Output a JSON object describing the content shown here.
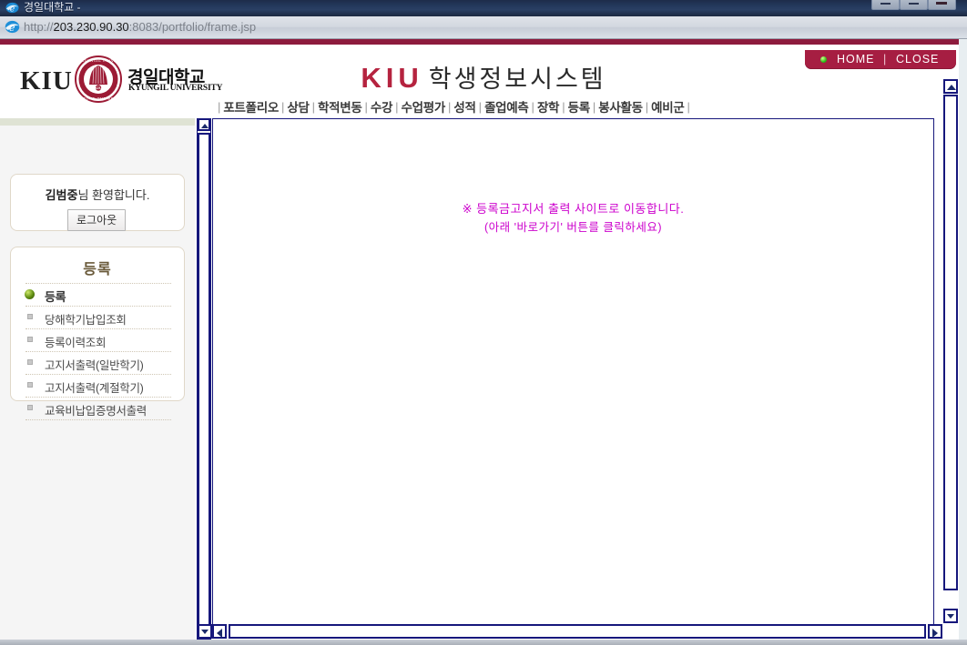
{
  "window": {
    "title": "경일대학교 -",
    "minimize_label": "Minimize",
    "maximize_label": "Maximize",
    "close_label": "Close"
  },
  "address_bar": {
    "protocol": "http://",
    "host": "203.230.90.30",
    "rest": ":8083/portfolio/frame.jsp",
    "full_url": "http://203.230.90.30:8083/portfolio/frame.jsp"
  },
  "header": {
    "logo_mark": "KIU",
    "logo_seal_text": "KYUNGIL UNIVERSITY",
    "logo_seal_inner": "KIU",
    "logo_seal_motto": "BEYOND THE BEST",
    "logo_korean": "경일대학교",
    "logo_english": "KYUNGIL UNIVERSITY",
    "site_title_mark": "KIU",
    "site_title_text": "학생정보시스템",
    "accent_color": "#8d1b3d",
    "title_accent_color": "#b5233f"
  },
  "home_close": {
    "home_label": "HOME",
    "separator": "|",
    "close_label": "CLOSE",
    "dot_color": "#2fbd18",
    "background_color": "#a61e42"
  },
  "nav": {
    "separator": "|",
    "items": [
      {
        "label": "포트폴리오"
      },
      {
        "label": "상담"
      },
      {
        "label": "학적변동"
      },
      {
        "label": "수강"
      },
      {
        "label": "수업평가"
      },
      {
        "label": "성적"
      },
      {
        "label": "졸업예측"
      },
      {
        "label": "장학"
      },
      {
        "label": "등록"
      },
      {
        "label": "봉사활동"
      },
      {
        "label": "예비군"
      }
    ]
  },
  "sidebar": {
    "welcome": {
      "user_name": "김범중",
      "suffix": "님 환영합니다.",
      "logout_label": "로그아웃"
    },
    "menu": {
      "title": "등록",
      "items": [
        {
          "label": "등록",
          "active": true
        },
        {
          "label": "당해학기납입조회",
          "active": false
        },
        {
          "label": "등록이력조회",
          "active": false
        },
        {
          "label": "고지서출력(일반학기)",
          "active": false
        },
        {
          "label": "고지서출력(계절학기)",
          "active": false
        },
        {
          "label": "교육비납입증명서출력",
          "active": false
        }
      ]
    }
  },
  "main": {
    "message_line1": "※ 등록금고지서 출력 사이트로 이동합니다.",
    "message_line2": "(아래 '바로가기' 버튼를 클릭하세요)",
    "message_color": "#cc00cc"
  }
}
